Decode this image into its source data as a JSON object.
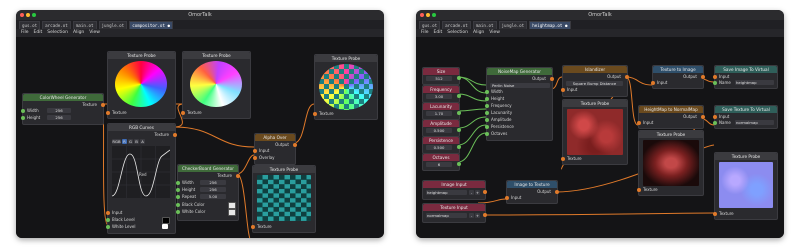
{
  "left": {
    "title": "OmorTalk",
    "tabs": [
      "gus.ot",
      "arcade.ot",
      "main.ot",
      "jungle.ot",
      "compositor.ot ●"
    ],
    "active_tab": 4,
    "menu": [
      "File",
      "Edit",
      "Selection",
      "Align",
      "View"
    ],
    "nodes": {
      "colorwheel": {
        "title": "ColorWheel Generator",
        "out": "Texture",
        "width_label": "Width",
        "width": "256",
        "height_label": "Height",
        "height": "256"
      },
      "probe1": {
        "title": "Texture Probe",
        "in": "Texture"
      },
      "probe2": {
        "title": "Texture Probe",
        "in": "Texture"
      },
      "probe3": {
        "title": "Texture Probe",
        "in": "Texture"
      },
      "probe4": {
        "title": "Texture Probe",
        "in": "Texture"
      },
      "rgbcurves": {
        "title": "RGB Curves",
        "out": "Texture",
        "channels": [
          "RGB",
          "R",
          "G",
          "B",
          "A"
        ],
        "curve_label": "Red",
        "input": "Input",
        "black": "Black Level",
        "white": "White Level"
      },
      "alphaover": {
        "title": "Alpha Over",
        "out": "Output",
        "input": "Input",
        "overlay": "Overlay"
      },
      "checker": {
        "title": "CheckerBoard Generator",
        "out": "Texture",
        "width_label": "Width",
        "width": "256",
        "height_label": "Height",
        "height": "256",
        "repeat_label": "Repeat",
        "repeat": "5.00",
        "black": "Black Color",
        "white": "White Color"
      }
    }
  },
  "right": {
    "title": "OmorTalk",
    "tabs": [
      "gus.ot",
      "arcade.ot",
      "main.ot",
      "jungle.ot",
      "heightmap.ot ●"
    ],
    "active_tab": 4,
    "menu": [
      "File",
      "Edit",
      "Selection",
      "Align",
      "View"
    ],
    "nodes": {
      "size": {
        "title": "Size",
        "value": "512"
      },
      "frequency": {
        "title": "Frequency",
        "value": "3.00"
      },
      "lacunarity": {
        "title": "Lacunarity",
        "value": "1.70"
      },
      "amplitude": {
        "title": "Amplitude",
        "value": "0.500"
      },
      "persistence": {
        "title": "Persistence",
        "value": "0.500"
      },
      "octaves": {
        "title": "Octaves",
        "value": "6"
      },
      "noisemap": {
        "title": "NoiseMap Generator",
        "out": "Output",
        "mode": "Perlin Noise",
        "inputs": [
          "Width",
          "Height",
          "Frequency",
          "Lacunarity",
          "Amplitude",
          "Persistence",
          "Octaves"
        ]
      },
      "islandizer": {
        "title": "Islandizer",
        "out": "Output",
        "mode": "Square Bump Distance",
        "in": "Input"
      },
      "texture_to_image": {
        "title": "Texture to Image",
        "out": "Output",
        "in": "Input"
      },
      "save1": {
        "title": "Save Image To Virtual",
        "input": "Input",
        "name_label": "Name",
        "name": "heightmap"
      },
      "save2": {
        "title": "Save Texture To Virtual",
        "input": "Input",
        "name_label": "Name",
        "name": "normalmap"
      },
      "heightmap_normal": {
        "title": "HeightMap to NormalMap",
        "out": "Output",
        "in": "Input"
      },
      "probe_a": {
        "title": "Texture Probe",
        "in": "Texture"
      },
      "probe_b": {
        "title": "Texture Probe",
        "in": "Texture"
      },
      "probe_c": {
        "title": "Texture Probe",
        "in": "Texture"
      },
      "image_input": {
        "title": "Image Input",
        "value": "heightmap"
      },
      "image_to_texture": {
        "title": "Image to Texture",
        "out": "Output",
        "in": "Input"
      },
      "texture_input": {
        "title": "Texture Input",
        "value": "normalmap"
      }
    }
  }
}
